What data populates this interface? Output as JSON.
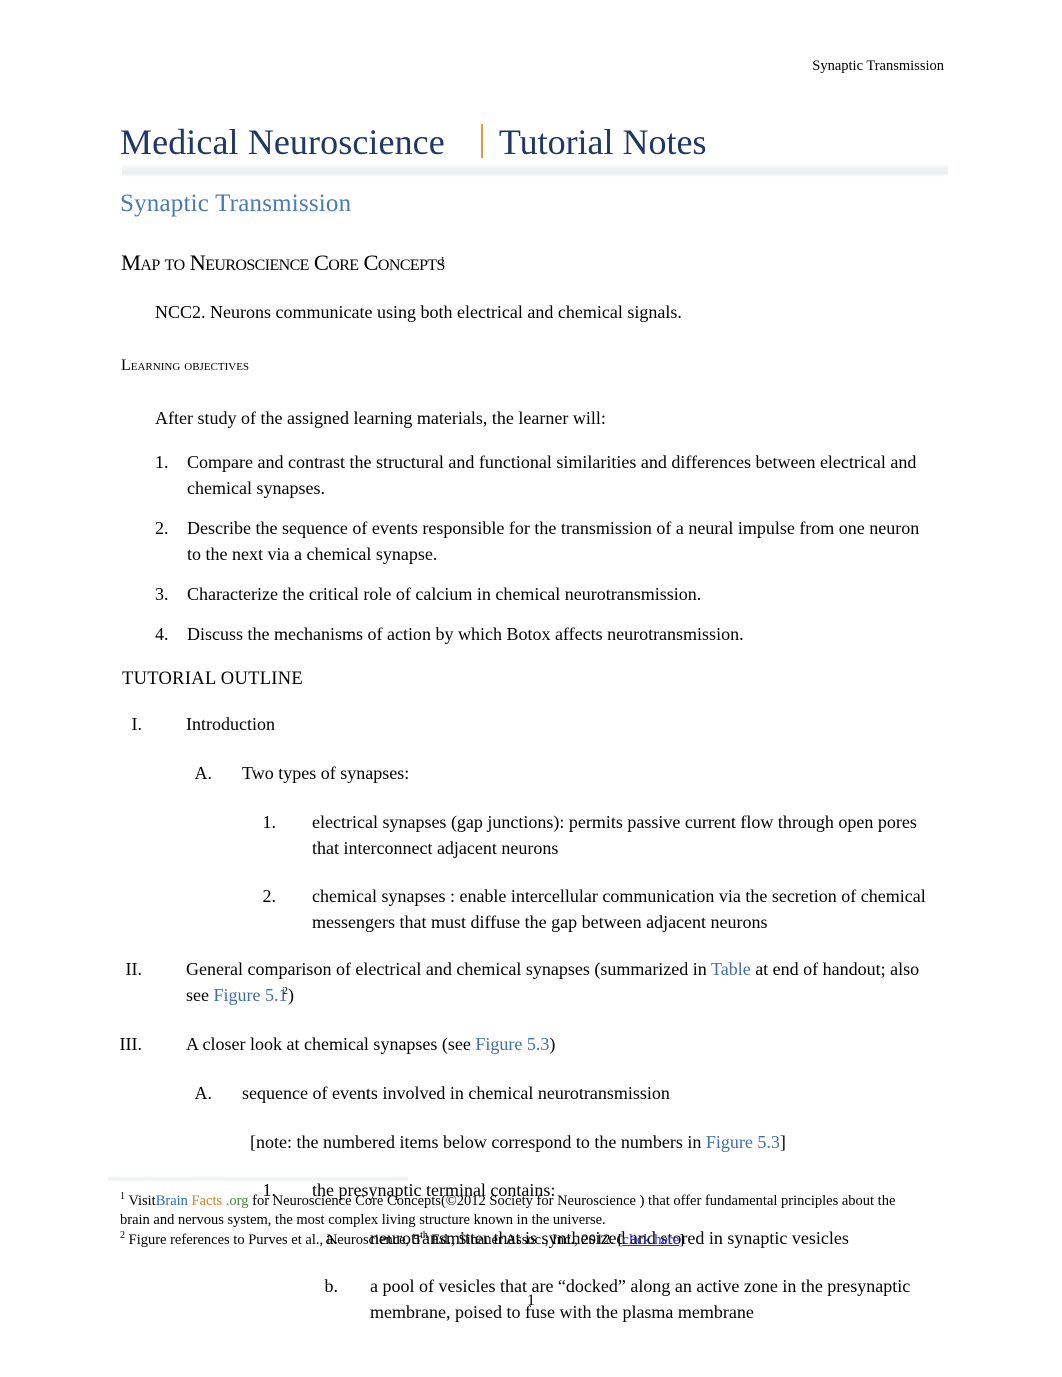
{
  "header": {
    "running_title": "Synaptic Transmission"
  },
  "masthead": {
    "main_title": "Medical Neuroscience",
    "sub_title": "Tutorial Notes",
    "separator_color": "#e8973a",
    "title_color": "#1f3864"
  },
  "doc": {
    "subtitle": "Synaptic Transmission",
    "subtitle_color": "#4a7ab5"
  },
  "sections": {
    "map_heading": {
      "part1": "Map to ",
      "part2": "Neuroscience ",
      "part3": "Core ",
      "part4": "Concepts",
      "footnote_marker": "1"
    },
    "ncc_line": "NCC2.  Neurons communicate using both electrical and chemical signals.",
    "objectives_heading": "Learning objectives",
    "objectives_intro": "After study of the assigned learning materials, the learner will:",
    "objectives": [
      {
        "num": "1.",
        "text": "Compare and contrast the structural and functional similarities and differences between electrical and chemical synapses."
      },
      {
        "num": "2.",
        "text": "Describe the sequence of events responsible for the transmission of a neural impulse from one neuron to the next via a chemical synapse."
      },
      {
        "num": "3.",
        "text": "Characterize the critical role of calcium in chemical neurotransmission."
      },
      {
        "num": "4.",
        "text": "Discuss the mechanisms of action by which Botox affects neurotransmission."
      }
    ],
    "outline_heading": "TUTORIAL OUTLINE"
  },
  "outline": {
    "i_marker": "I.",
    "i_text": "Introduction",
    "i_a_marker": "A.",
    "i_a_text": "Two types of synapses:",
    "i_a_1_marker": "1.",
    "i_a_1_text": "electrical  synapses  (gap junctions):  permits passive current flow through open pores that interconnect adjacent neurons",
    "i_a_2_marker": "2.",
    "i_a_2_text": "chemical synapses :  enable intercellular communication via the secretion of chemical messengers that must diffuse the gap between adjacent neurons",
    "ii_marker": "II.",
    "ii_text_pre": "General comparison of electrical and chemical synapses (summarized in ",
    "ii_link_table": "Table",
    "ii_text_mid": " at end of handout; also see ",
    "ii_link_fig51": "Figure 5.1",
    "ii_fig51_footnote": "2",
    "ii_text_post": ")",
    "iii_marker": "III.",
    "iii_text_pre": "A closer look at chemical synapses (see ",
    "iii_link_fig53": "Figure 5.3",
    "iii_text_post": ")",
    "iii_a_marker": "A.",
    "iii_a_text": "sequence of events involved in chemical neurotransmission",
    "iii_a_note_pre": "[note: the numbered items below correspond to the numbers in   ",
    "iii_a_note_link": "Figure 5.3",
    "iii_a_note_post": "]",
    "iii_a_1_marker": "1.",
    "iii_a_1_text": "the presynaptic terminal contains:",
    "iii_a_1_a_marker": "a.",
    "iii_a_1_a_text": "neurotransmitter that is synthesized and stored in synaptic vesicles",
    "iii_a_1_b_marker": "b.",
    "iii_a_1_b_text": "a pool of vesicles that are “docked” along an active zone in the presynaptic membrane, poised to fuse with the plasma membrane"
  },
  "footnotes": {
    "fn1_mark": "1",
    "fn1_pre": " Visit",
    "fn1_brain": "Brain",
    "fn1_facts": " Facts",
    "fn1_org": " .org",
    "fn1_post": "  for Neuroscience Core Concepts(©2012 Society for Neuroscience ) that offer fundamental principles about the brain and nervous system, the most complex living structure known in the universe.",
    "fn2_mark": "2",
    "fn2_pre": " Figure references to Purves et al.,  Neuroscience, 5",
    "fn2_sup": "th",
    "fn2_mid": " Ed., Sinauer Assoc., Inc., 2012. [",
    "fn2_link": "click here",
    "fn2_post": "]",
    "brain_color": "#2b6cb8",
    "facts_color": "#e07b22",
    "org_color": "#3b8f3b",
    "click_here_color": "#2a2ae0"
  },
  "page_number": "1"
}
